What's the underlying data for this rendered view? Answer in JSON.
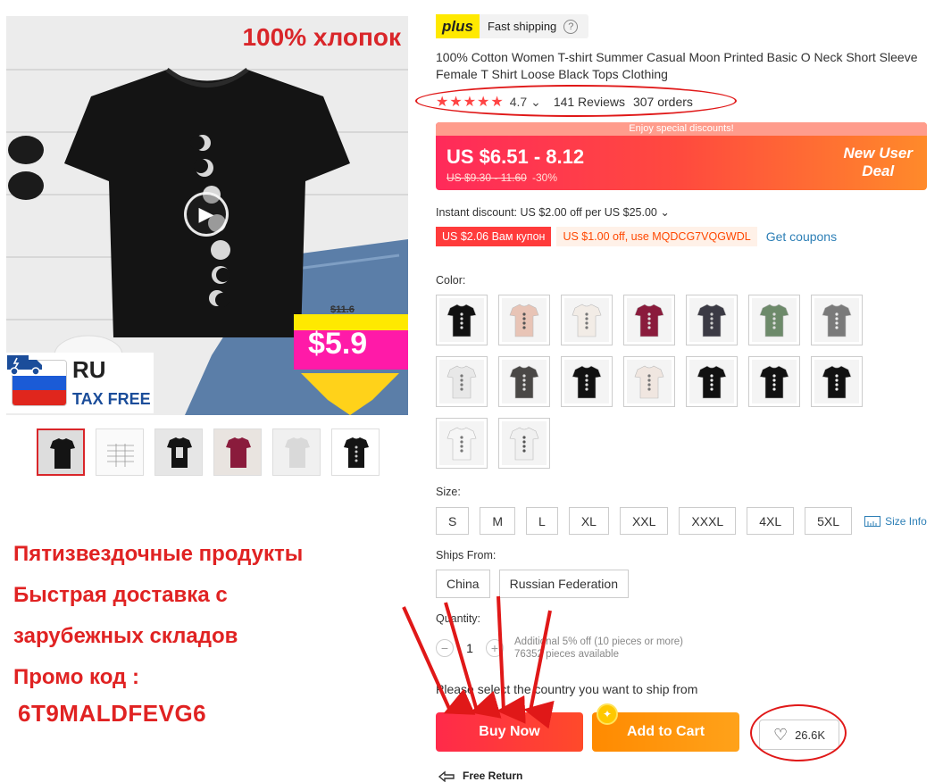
{
  "media": {
    "headline": "100% хлопок",
    "ru_badge": {
      "code": "RU",
      "label": "TAX FREE"
    },
    "price_sticker": {
      "old": "$11.6",
      "new": "$5.9"
    },
    "thumbnails": [
      "thumb-1",
      "thumb-2",
      "thumb-3",
      "thumb-4",
      "thumb-5",
      "thumb-6"
    ]
  },
  "promo": {
    "lines": [
      "Пятизвездочные продукты",
      "Быстрая доставка с",
      "зарубежных складов",
      "Промо код :"
    ],
    "code": "6T9MALDFEVG6"
  },
  "header": {
    "plus_logo": "plus",
    "fast_shipping": "Fast shipping",
    "help_icon": "?"
  },
  "product": {
    "title": "100% Cotton Women T-shirt Summer Casual Moon Printed Basic O Neck Short Sleeve Female T Shirt Loose Black Tops Clothing",
    "stars": "★★★★★",
    "rating": "4.7",
    "reviews": "141 Reviews",
    "orders": "307 orders"
  },
  "price": {
    "strip": "Enjoy special discounts!",
    "current": "US $6.51 - 8.12",
    "old": "US $9.30 - 11.60",
    "discount": "-30%",
    "promo_line1": "New User",
    "promo_line2": "Deal"
  },
  "discounts": {
    "instant": "Instant discount: US $2.00 off per US $25.00",
    "coupon_1": "US $2.06 Вам купон",
    "coupon_2": "US $1.00 off, use MQDCG7VQGWDL",
    "get_coupons": "Get coupons"
  },
  "color": {
    "label": "Color:",
    "swatches": [
      {
        "bg": "#111111",
        "print": "#dddddd"
      },
      {
        "bg": "#e8c4b6",
        "print": "#555555"
      },
      {
        "bg": "#f2ece6",
        "print": "#777777"
      },
      {
        "bg": "#8a1b3c",
        "print": "#dddddd"
      },
      {
        "bg": "#3b3a44",
        "print": "#cccccc"
      },
      {
        "bg": "#6d8a6a",
        "print": "#dddddd"
      },
      {
        "bg": "#7a7a7a",
        "print": "#eeeeee"
      },
      {
        "bg": "#e8e8e8",
        "print": "#777777"
      },
      {
        "bg": "#4a4846",
        "print": "#dddddd"
      },
      {
        "bg": "#111111",
        "print": "#dddddd"
      },
      {
        "bg": "#f0e6e0",
        "print": "#777777"
      },
      {
        "bg": "#111111",
        "print": "#eeeeee"
      },
      {
        "bg": "#111111",
        "print": "#eeeeee"
      },
      {
        "bg": "#111111",
        "print": "#eeeeee"
      },
      {
        "bg": "#f6f6f6",
        "print": "#777777"
      },
      {
        "bg": "#f0f0f0",
        "print": "#555555"
      }
    ]
  },
  "size": {
    "label": "Size:",
    "options": [
      "S",
      "M",
      "L",
      "XL",
      "XXL",
      "XXXL",
      "4XL",
      "5XL"
    ],
    "info": "Size Info"
  },
  "ships": {
    "label": "Ships From:",
    "options": [
      "China",
      "Russian Federation"
    ]
  },
  "quantity": {
    "label": "Quantity:",
    "minus": "−",
    "value": "1",
    "plus": "+",
    "info_1": "Additional 5% off (10 pieces or more)",
    "info_2": "76352 pieces available"
  },
  "actions": {
    "ship_note": "Please select the country you want to ship from",
    "buy_now": "Buy Now",
    "add_to_cart": "Add to Cart",
    "wishlist_count": "26.6K",
    "free_return": "Free Return"
  },
  "colors": {
    "accent_red": "#ff2a4a",
    "annotation_red": "#e01818",
    "orange": "#ff8a00",
    "link_blue": "#2d7fb6"
  }
}
